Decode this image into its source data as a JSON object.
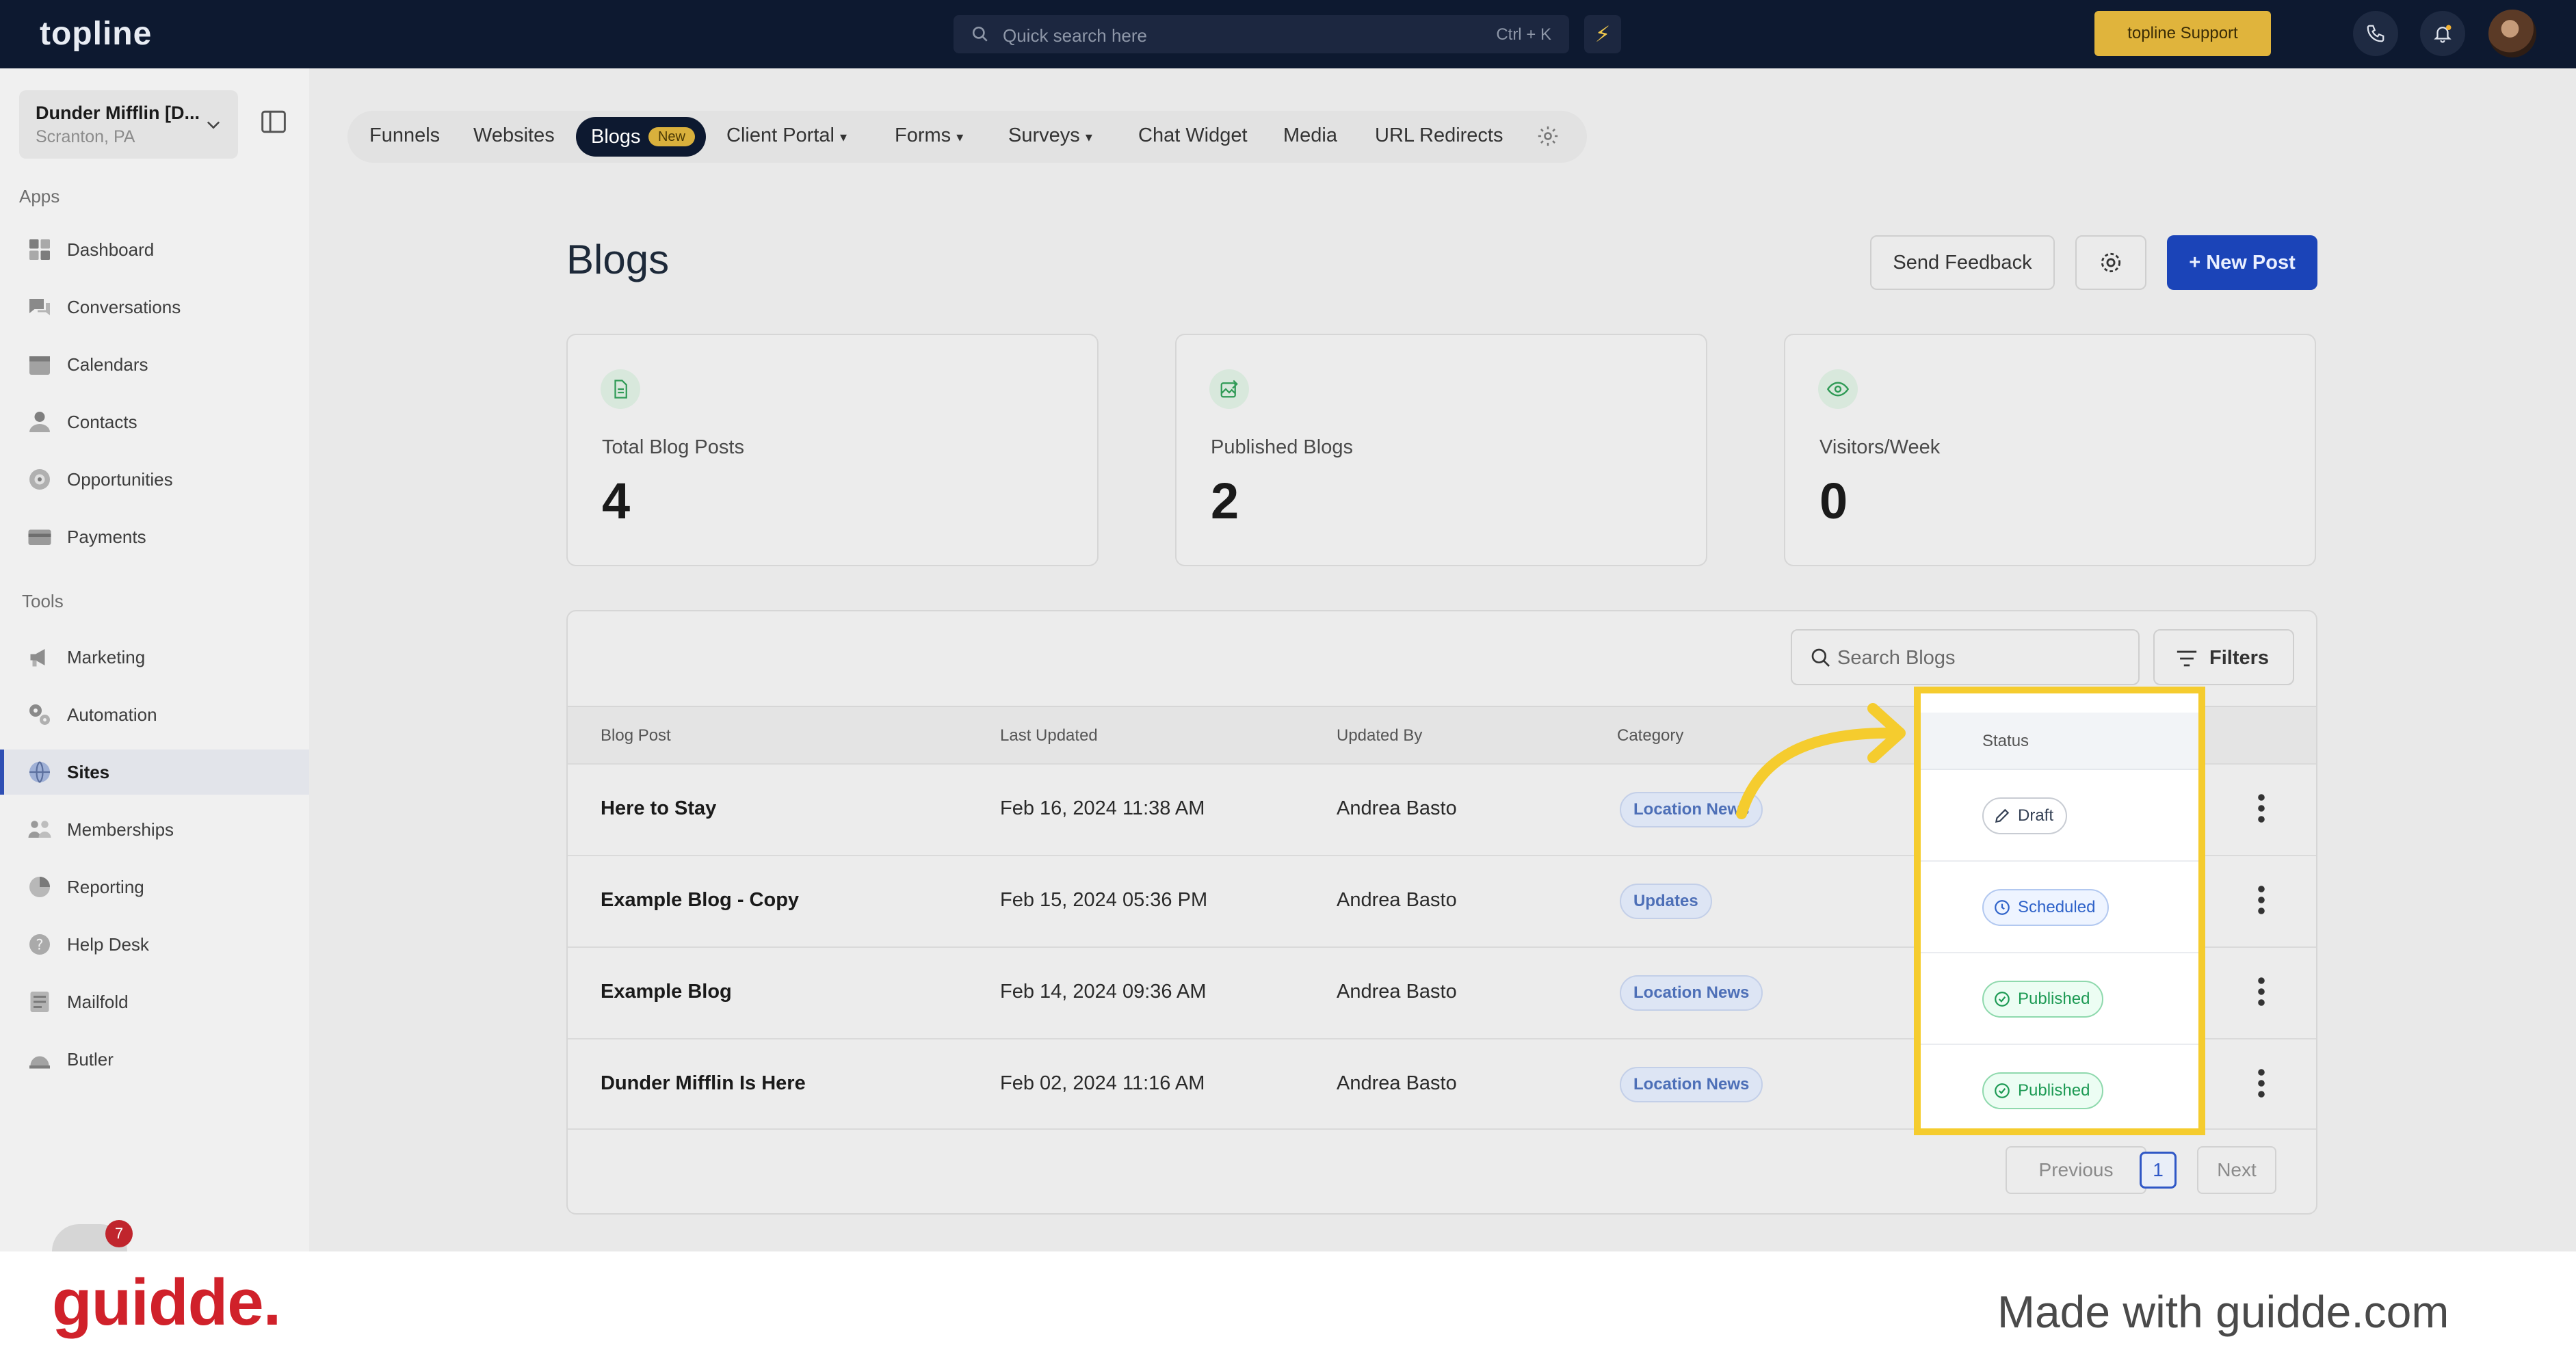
{
  "topbar": {
    "logo": "topline",
    "search_placeholder": "Quick search here",
    "search_shortcut": "Ctrl + K",
    "support_label": "topline Support"
  },
  "sidebar": {
    "account_name": "Dunder Mifflin [D...",
    "account_location": "Scranton, PA",
    "apps_heading": "Apps",
    "tools_heading": "Tools",
    "apps": [
      {
        "label": "Dashboard",
        "icon": "dashboard-icon"
      },
      {
        "label": "Conversations",
        "icon": "chat-icon"
      },
      {
        "label": "Calendars",
        "icon": "calendar-icon"
      },
      {
        "label": "Contacts",
        "icon": "contact-icon"
      },
      {
        "label": "Opportunities",
        "icon": "target-icon"
      },
      {
        "label": "Payments",
        "icon": "card-icon"
      }
    ],
    "tools": [
      {
        "label": "Marketing",
        "icon": "megaphone-icon"
      },
      {
        "label": "Automation",
        "icon": "gears-icon"
      },
      {
        "label": "Sites",
        "icon": "globe-icon",
        "active": true
      },
      {
        "label": "Memberships",
        "icon": "users-icon"
      },
      {
        "label": "Reporting",
        "icon": "pie-icon"
      },
      {
        "label": "Help Desk",
        "icon": "help-icon"
      },
      {
        "label": "Mailfold",
        "icon": "mail-icon"
      },
      {
        "label": "Butler",
        "icon": "butler-icon"
      }
    ],
    "notification_count": "7"
  },
  "subnav": {
    "tabs": [
      "Funnels",
      "Websites",
      "Blogs",
      "Client Portal",
      "Forms",
      "Surveys",
      "Chat Widget",
      "Media",
      "URL Redirects"
    ],
    "blogs_badge": "New"
  },
  "main": {
    "title": "Blogs",
    "send_feedback": "Send Feedback",
    "new_post": "+ New Post",
    "stats": [
      {
        "label": "Total Blog Posts",
        "value": "4",
        "icon": "document-icon"
      },
      {
        "label": "Published Blogs",
        "value": "2",
        "icon": "image-edit-icon"
      },
      {
        "label": "Visitors/Week",
        "value": "0",
        "icon": "eye-icon"
      }
    ],
    "search_placeholder": "Search Blogs",
    "filters_label": "Filters",
    "columns": [
      "Blog Post",
      "Last Updated",
      "Updated By",
      "Category",
      "Status"
    ],
    "rows": [
      {
        "post": "Here to Stay",
        "updated": "Feb 16, 2024 11:38 AM",
        "by": "Andrea Basto",
        "category": "Location News",
        "status": "Draft"
      },
      {
        "post": "Example Blog - Copy",
        "updated": "Feb 15, 2024 05:36 PM",
        "by": "Andrea Basto",
        "category": "Updates",
        "status": "Scheduled"
      },
      {
        "post": "Example Blog",
        "updated": "Feb 14, 2024 09:36 AM",
        "by": "Andrea Basto",
        "category": "Location News",
        "status": "Published"
      },
      {
        "post": "Dunder Mifflin Is Here",
        "updated": "Feb 02, 2024 11:16 AM",
        "by": "Andrea Basto",
        "category": "Location News",
        "status": "Published"
      }
    ],
    "pagination": {
      "previous": "Previous",
      "current": "1",
      "next": "Next"
    }
  },
  "footer": {
    "brand": "guidde.",
    "made_with": "Made with guidde.com"
  },
  "colors": {
    "topbar": "#0d1930",
    "primary": "#1b44b8",
    "highlight": "#f5cc2e",
    "brand_red": "#d0212a"
  }
}
